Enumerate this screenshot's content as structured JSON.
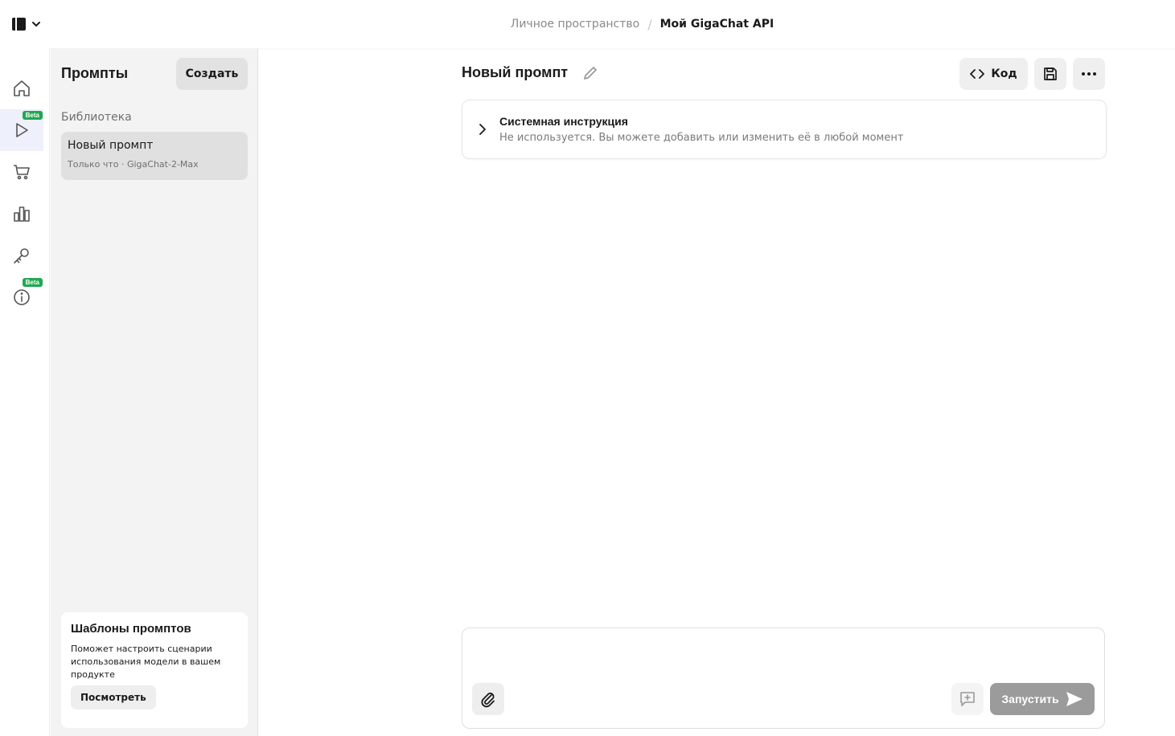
{
  "topbar": {
    "breadcrumb_parent": "Личное пространство",
    "breadcrumb_separator": "/",
    "breadcrumb_current": "Мой GigaChat API"
  },
  "rail": {
    "items": [
      {
        "icon": "home-icon",
        "active": false,
        "badge": ""
      },
      {
        "icon": "play-icon",
        "active": true,
        "badge": "Beta"
      },
      {
        "icon": "cart-icon",
        "active": false,
        "badge": ""
      },
      {
        "icon": "bar-chart-icon",
        "active": false,
        "badge": ""
      },
      {
        "icon": "key-icon",
        "active": false,
        "badge": ""
      },
      {
        "icon": "info-icon",
        "active": false,
        "badge": "Beta"
      }
    ]
  },
  "prompts_panel": {
    "title": "Промпты",
    "create_label": "Создать",
    "library_label": "Библиотека",
    "items": [
      {
        "title": "Новый промпт",
        "subtitle": "Только что · GigaChat-2-Max"
      }
    ],
    "templates": {
      "title": "Шаблоны промптов",
      "description": "Поможет настроить сценарии использования модели в вашем продукте",
      "button_label": "Посмотреть"
    }
  },
  "editor": {
    "title": "Новый промпт",
    "code_label": "Код",
    "system_instruction": {
      "title": "Системная инструкция",
      "subtitle": "Не используется. Вы можете добавить или изменить её в любой момент"
    },
    "composer": {
      "value": "",
      "run_label": "Запустить"
    }
  },
  "colors": {
    "badge_green": "#1fa84f",
    "run_button_disabled": "#9b9b9b",
    "active_rail_bg": "#eef0fb"
  }
}
